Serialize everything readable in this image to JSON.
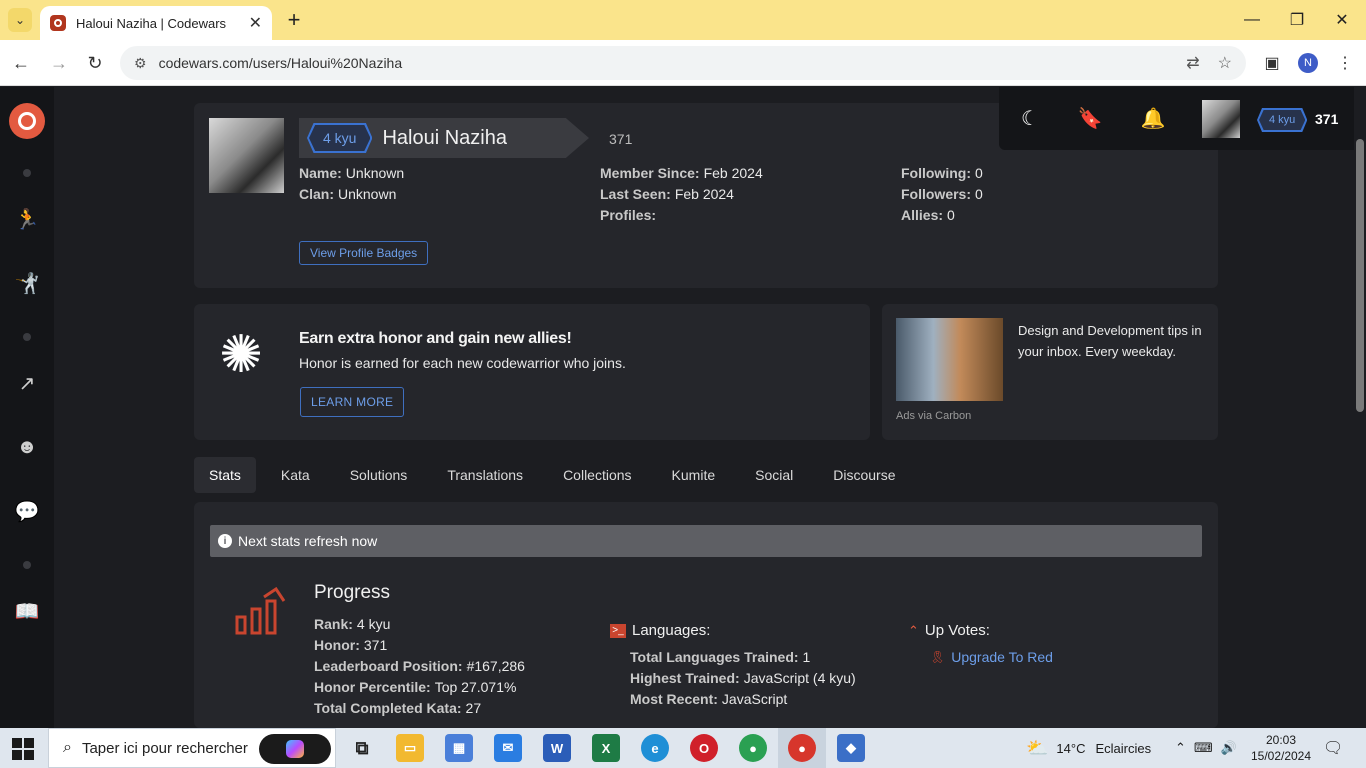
{
  "browser": {
    "tab_title": "Haloui Naziha | Codewars",
    "url": "codewars.com/users/Haloui%20Naziha",
    "profile_initial": "N"
  },
  "header": {
    "rank": "4 kyu",
    "honor": "371"
  },
  "profile": {
    "rank": "4 kyu",
    "username": "Haloui Naziha",
    "honor": "371",
    "name_label": "Name:",
    "name_value": "Unknown",
    "clan_label": "Clan:",
    "clan_value": "Unknown",
    "member_since_label": "Member Since:",
    "member_since_value": "Feb 2024",
    "last_seen_label": "Last Seen:",
    "last_seen_value": "Feb 2024",
    "profiles_label": "Profiles:",
    "following_label": "Following:",
    "following_value": "0",
    "followers_label": "Followers:",
    "followers_value": "0",
    "allies_label": "Allies:",
    "allies_value": "0",
    "badges_button": "View Profile Badges"
  },
  "promo": {
    "title": "Earn extra honor and gain new allies!",
    "subtitle": "Honor is earned for each new codewarrior who joins.",
    "button": "LEARN MORE"
  },
  "ad": {
    "text": "Design and Development tips in your inbox. Every weekday.",
    "via": "Ads via Carbon"
  },
  "tabs": [
    "Stats",
    "Kata",
    "Solutions",
    "Translations",
    "Collections",
    "Kumite",
    "Social",
    "Discourse"
  ],
  "stats": {
    "refresh_notice": "Next stats refresh now",
    "progress_title": "Progress",
    "rank_label": "Rank:",
    "rank_value": "4 kyu",
    "honor_label": "Honor:",
    "honor_value": "371",
    "leaderboard_label": "Leaderboard Position:",
    "leaderboard_value": "#167,286",
    "percentile_label": "Honor Percentile:",
    "percentile_value": "Top 27.071%",
    "completed_label": "Total Completed Kata:",
    "completed_value": "27",
    "languages_title": "Languages:",
    "languages_trained_label": "Total Languages Trained:",
    "languages_trained_value": "1",
    "highest_trained_label": "Highest Trained:",
    "highest_trained_value": "JavaScript (4 kyu)",
    "most_recent_label": "Most Recent:",
    "most_recent_value": "JavaScript",
    "upvotes_title": "Up Votes:",
    "upgrade_link": "Upgrade To Red"
  },
  "taskbar": {
    "search_placeholder": "Taper ici pour rechercher",
    "weather_temp": "14°C",
    "weather_text": "Eclaircies",
    "time": "20:03",
    "date": "15/02/2024"
  },
  "colors": {
    "accent_blue": "#3a72d1",
    "codewars_red": "#e35a40",
    "tab_strip": "#fae48b"
  }
}
